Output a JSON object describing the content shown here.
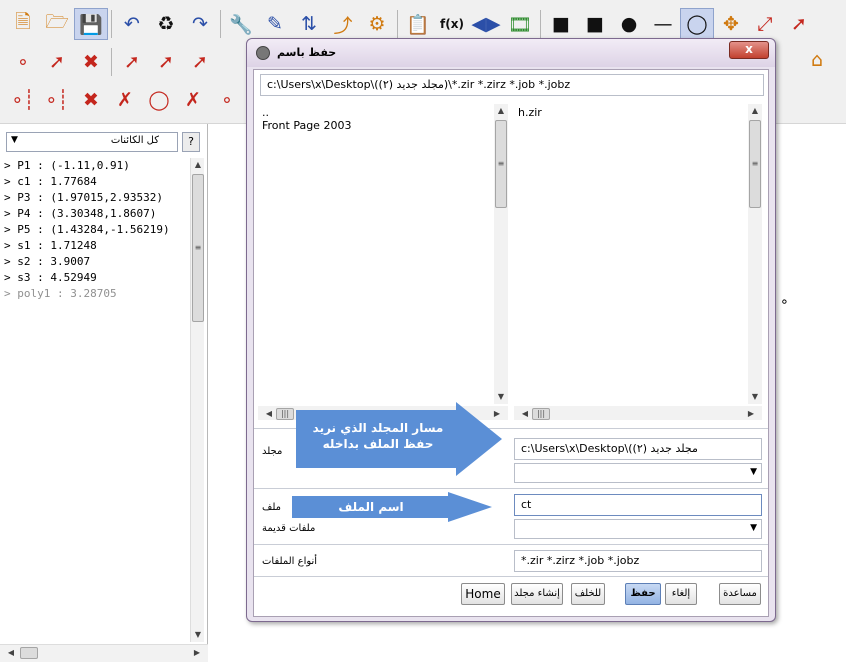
{
  "toolbar": {
    "row1": [
      "new-file-icon",
      "open-folder-icon",
      "save-icon",
      "undo-icon",
      "clear-icon",
      "redo-icon",
      "tools-icon",
      "paint-icon",
      "sort-icon",
      "segment-icon",
      "settings-icon",
      "properties-icon",
      "fx-icon",
      "reflect-icon",
      "film-icon",
      "black-square-icon",
      "black-square-icon",
      "dot-icon",
      "line-icon",
      "circle-icon",
      "move-icon",
      "ray-icon",
      "vector-icon"
    ],
    "row1_fx_label": "f(x)",
    "row2": [
      "point-icon",
      "segment-icon",
      "intersect-icon",
      "line-icon",
      "line-icon",
      "line-icon"
    ],
    "row3": [
      "point-icon",
      "point-icon",
      "cross-icon",
      "cross-icon",
      "circle-icon",
      "cross-icon",
      "cross-icon"
    ]
  },
  "algebra": {
    "filter_label": "كل الكائنات",
    "help_label": "?",
    "items": [
      "> P1 : (-1.11,0.91)",
      "> c1 : 1.77684",
      "> P3 : (1.97015,2.93532)",
      "> P4 : (3.30348,1.8607)",
      "> P5 : (1.43284,-1.56219)",
      "> s1 : 1.71248",
      "> s2 : 3.9007",
      "> s3 : 4.52949",
      "> poly1 : 3.28705"
    ]
  },
  "dialog": {
    "title": "حفظ باسم",
    "close_label": "x",
    "filter_path": "c:\\Users\\x\\Desktop\\(مجلد جديد (٢))\\*.zir *.zirz *.job *.jobz",
    "left_list": [
      "..",
      "Front Page 2003"
    ],
    "right_list": [
      "h.zir"
    ],
    "folder_label": "مجلد",
    "folder_value": "c:\\Users\\x\\Desktop\\(مجلد جديد (٢)",
    "file_label": "ملف",
    "file_value": "ct",
    "old_files_label": "ملفات قديمة",
    "file_types_label": "أنواع الملفات",
    "file_types_value": "*.zir *.zirz *.job *.jobz",
    "buttons": {
      "home": "Home",
      "new_folder": "إنشاء مجلد",
      "back": "للخلف",
      "save": "حفظ",
      "cancel": "إلغاء",
      "help": "مساعدة"
    }
  },
  "annotations": {
    "folder_arrow": "مسار المجلد الذي نريد حفظ الملف بداخله",
    "file_arrow": "اسم الملف",
    "color": "#5b8fd6"
  }
}
